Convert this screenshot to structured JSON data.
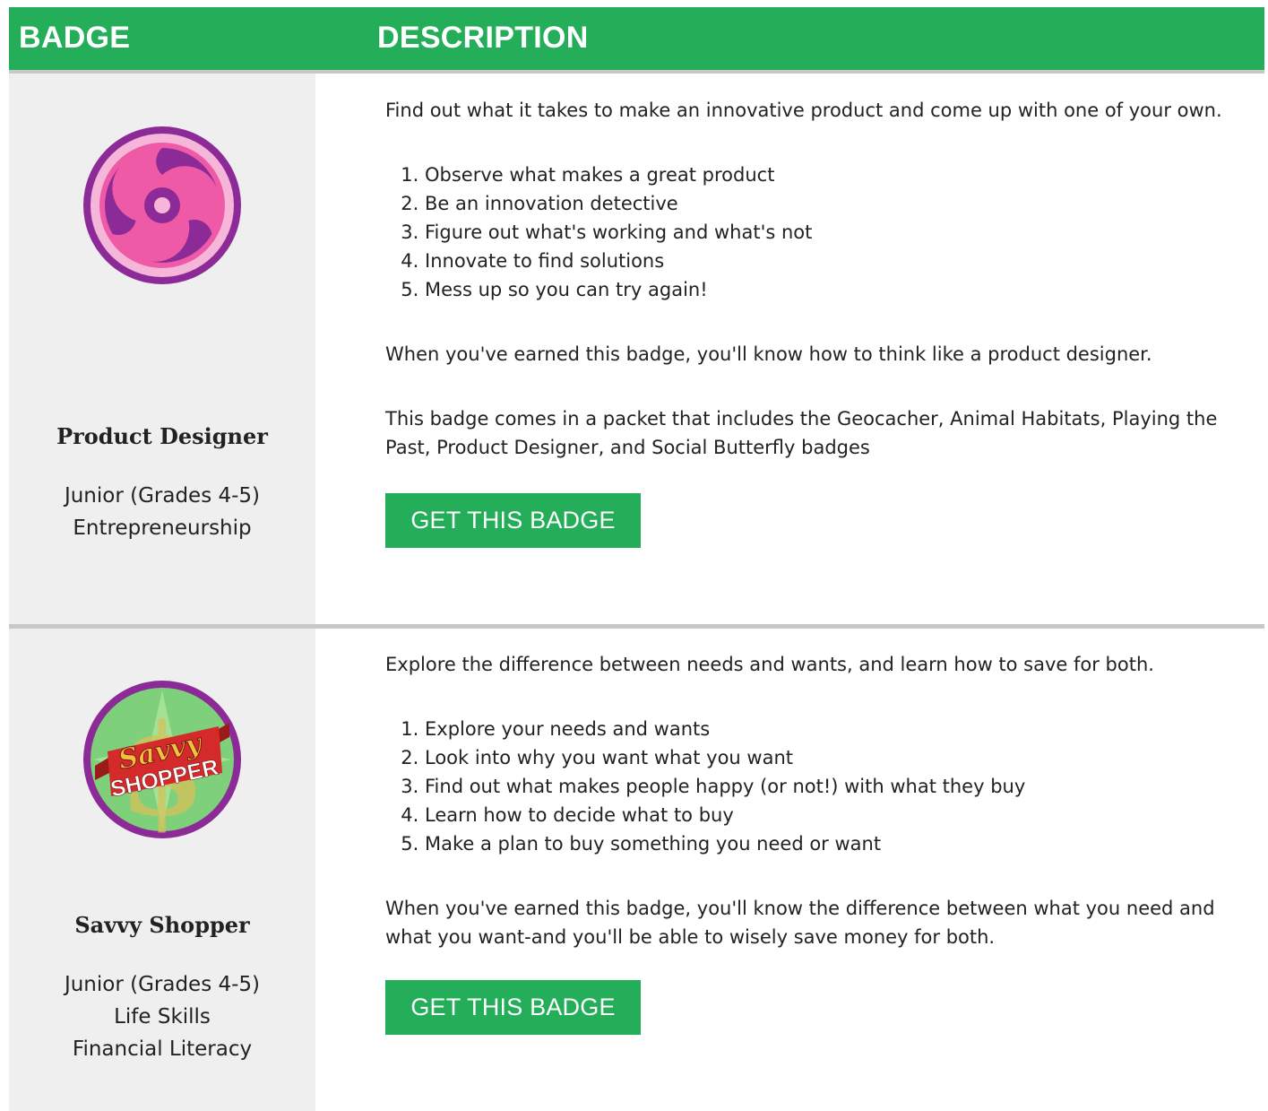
{
  "header": {
    "badge_label": "BADGE",
    "description_label": "DESCRIPTION"
  },
  "colors": {
    "accent_green": "#25ae5a",
    "badge_panel_gray": "#efefef",
    "divider_gray": "#c8c8c8"
  },
  "badges": [
    {
      "icon": "product-designer-badge-icon",
      "name": "Product Designer",
      "meta": [
        "Junior (Grades 4-5)",
        "Entrepreneurship"
      ],
      "intro": "Find out what it takes to make an innovative product and come up with one of your own.",
      "steps": [
        "Observe what makes a great product",
        "Be an innovation detective",
        "Figure out what's working and what's not",
        "Innovate to find solutions",
        "Mess up so you can try again!"
      ],
      "outro": "When you've earned this badge, you'll know how to think like a product designer.",
      "note": "This badge comes in a packet that includes the Geocacher, Animal Habitats, Playing the Past, Product Designer, and Social Butterfly badges",
      "button": "GET THIS BADGE"
    },
    {
      "icon": "savvy-shopper-badge-icon",
      "name": "Savvy Shopper",
      "meta": [
        "Junior (Grades 4-5)",
        "Life Skills",
        "Financial Literacy"
      ],
      "intro": "Explore the difference between needs and wants, and learn how to save for both.",
      "steps": [
        "Explore your needs and wants",
        "Look into why you want what you want",
        "Find out what makes people happy (or not!) with what they buy",
        "Learn how to decide what to buy",
        "Make a plan to buy something you need or want"
      ],
      "outro": "When you've earned this badge, you'll know the difference between what you need and what you want-and you'll be able to wisely save money for both.",
      "button": "GET THIS BADGE",
      "icon_text": [
        "Savvy",
        "SHOPPER"
      ]
    }
  ]
}
